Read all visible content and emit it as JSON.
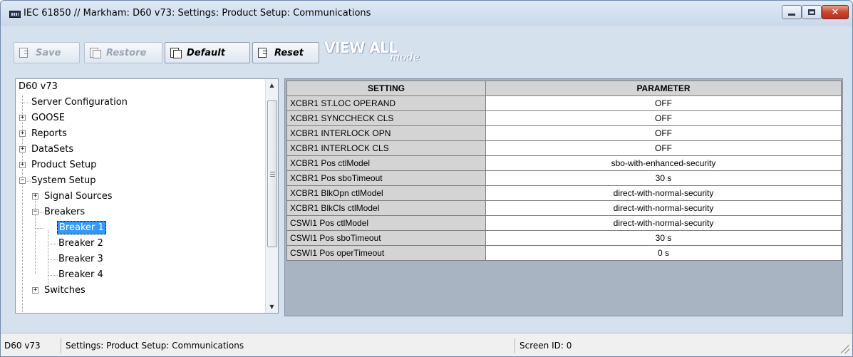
{
  "window": {
    "title": "IEC 61850 // Markham: D60 v73: Settings: Product Setup: Communications",
    "icon": "application-icon"
  },
  "toolbar": {
    "save_label": "Save",
    "restore_label": "Restore",
    "default_label": "Default",
    "reset_label": "Reset",
    "view_all_big": "VIEW ALL",
    "view_all_small": "mode"
  },
  "tree": {
    "root": "D60 v73",
    "items": [
      {
        "label": "Server Configuration"
      },
      {
        "label": "GOOSE"
      },
      {
        "label": "Reports"
      },
      {
        "label": "DataSets"
      },
      {
        "label": "Product Setup"
      },
      {
        "label": "System Setup"
      },
      {
        "label": "Signal Sources"
      },
      {
        "label": "Breakers"
      },
      {
        "label": "Breaker 1"
      },
      {
        "label": "Breaker 2"
      },
      {
        "label": "Breaker 3"
      },
      {
        "label": "Breaker 4"
      },
      {
        "label": "Switches"
      }
    ],
    "selected": "Breaker 1"
  },
  "table": {
    "headers": [
      "SETTING",
      "PARAMETER"
    ],
    "rows": [
      {
        "setting": "XCBR1 ST.LOC OPERAND",
        "parameter": "OFF"
      },
      {
        "setting": "XCBR1 SYNCCHECK CLS",
        "parameter": "OFF"
      },
      {
        "setting": "XCBR1 INTERLOCK OPN",
        "parameter": "OFF"
      },
      {
        "setting": "XCBR1 INTERLOCK CLS",
        "parameter": "OFF"
      },
      {
        "setting": "XCBR1 Pos ctlModel",
        "parameter": "sbo-with-enhanced-security"
      },
      {
        "setting": "XCBR1 Pos sboTimeout",
        "parameter": "30 s"
      },
      {
        "setting": "XCBR1 BlkOpn ctlModel",
        "parameter": "direct-with-normal-security"
      },
      {
        "setting": "XCBR1 BlkCls ctlModel",
        "parameter": "direct-with-normal-security"
      },
      {
        "setting": "CSWI1 Pos ctlModel",
        "parameter": "direct-with-normal-security"
      },
      {
        "setting": "CSWI1 Pos sboTimeout",
        "parameter": "30 s"
      },
      {
        "setting": "CSWI1 Pos operTimeout",
        "parameter": "0 s"
      }
    ]
  },
  "status": {
    "device": "D60 v73",
    "path": "Settings: Product Setup: Communications",
    "screen_id": "Screen ID: 0"
  },
  "colors": {
    "window_bg": "#d6e1ee",
    "selection": "#3399ff",
    "close_button": "#c8462c",
    "header_cell": "#d4d4d4"
  }
}
